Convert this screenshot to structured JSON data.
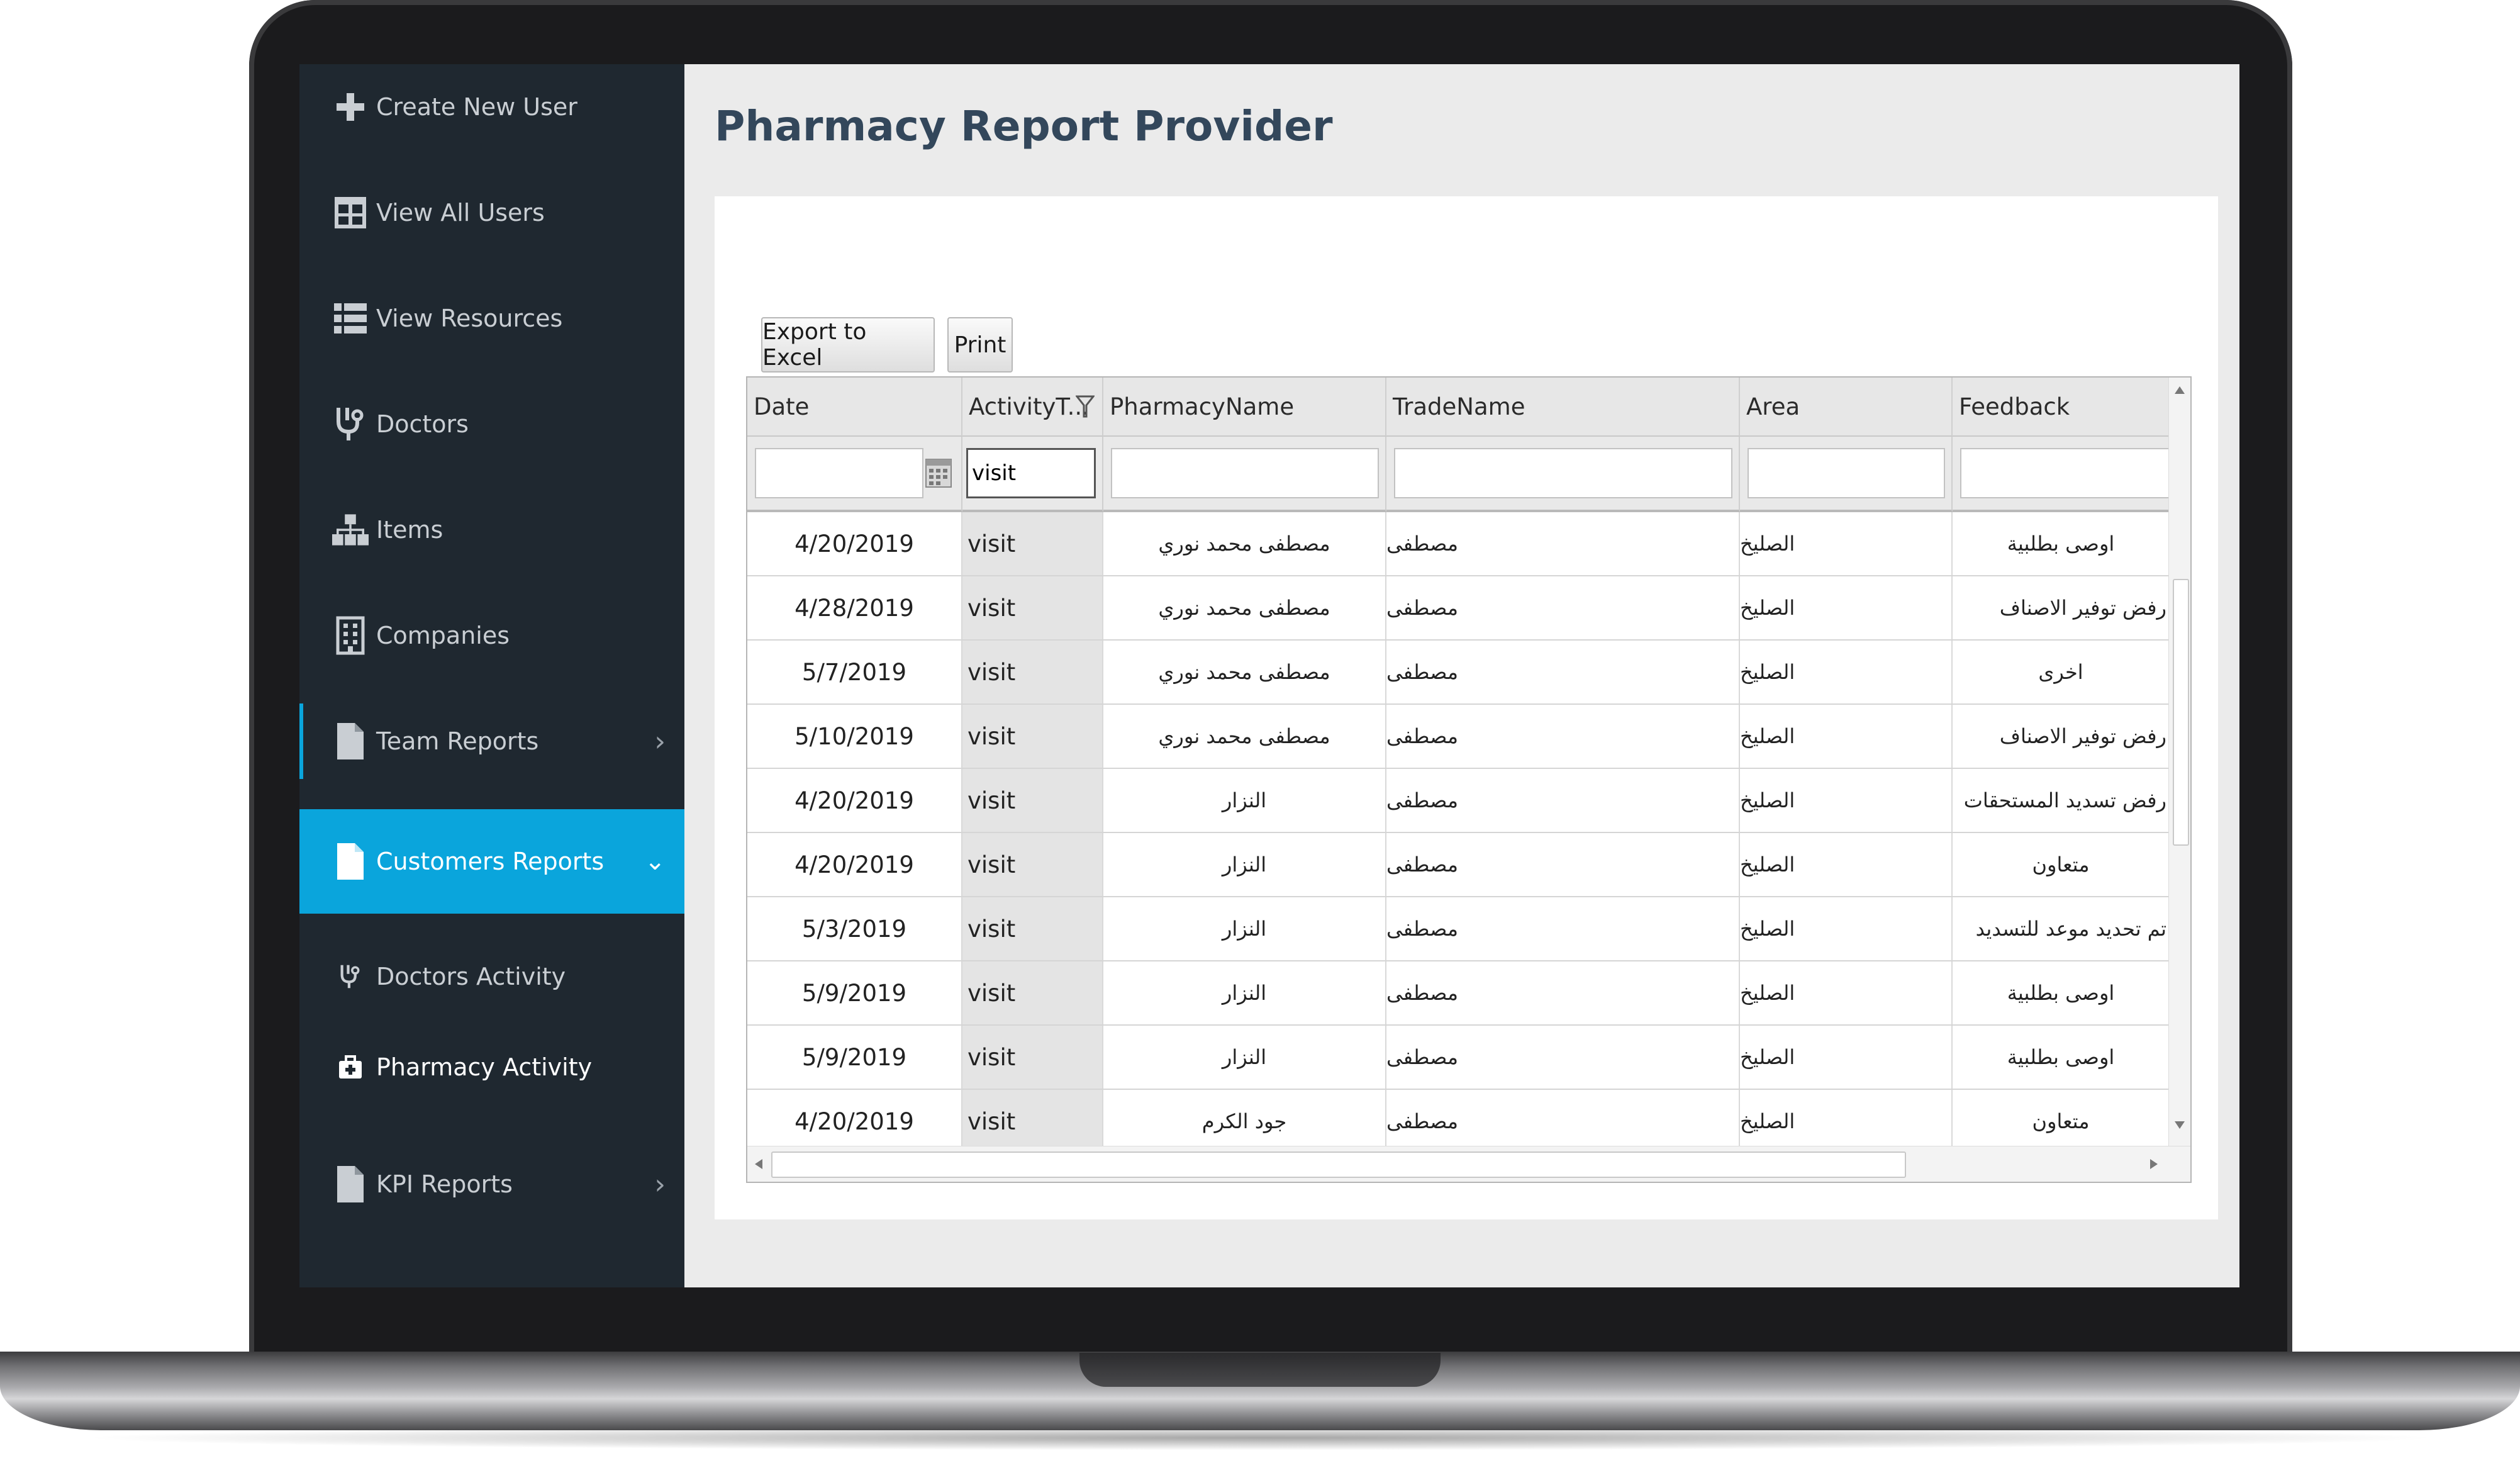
{
  "sidebar": {
    "items": [
      {
        "label": "Create New User",
        "icon": "plus-icon"
      },
      {
        "label": "View All Users",
        "icon": "table-icon"
      },
      {
        "label": "View Resources",
        "icon": "list-icon"
      },
      {
        "label": "Doctors",
        "icon": "stethoscope-icon"
      },
      {
        "label": "Items",
        "icon": "hierarchy-icon"
      },
      {
        "label": "Companies",
        "icon": "building-icon"
      },
      {
        "label": "Team Reports",
        "icon": "document-icon",
        "chevron": "›"
      },
      {
        "label": "Customers Reports",
        "icon": "document-icon",
        "chevron": "⌄"
      },
      {
        "label": "KPI Reports",
        "icon": "document-icon",
        "chevron": "›"
      }
    ],
    "subitems": [
      {
        "label": "Doctors Activity",
        "icon": "stethoscope-icon"
      },
      {
        "label": "Pharmacy Activity",
        "icon": "medical-bag-icon"
      }
    ]
  },
  "page": {
    "title": "Pharmacy Report Provider"
  },
  "toolbar": {
    "export_label": "Export to Excel",
    "print_label": "Print"
  },
  "grid": {
    "columns": [
      "Date",
      "ActivityT...",
      "PharmacyName",
      "TradeName",
      "Area",
      "Feedback"
    ],
    "filters": {
      "date": "",
      "activity": "visit",
      "pharmacy": "",
      "trade": "",
      "area": "",
      "feedback": ""
    },
    "rows": [
      {
        "date": "4/20/2019",
        "activity": "visit",
        "pharmacy": "مصطفى محمد نوري",
        "trade": "مصطفى",
        "area": "الصليخ",
        "feedback": "اوصى بطلبية"
      },
      {
        "date": "4/28/2019",
        "activity": "visit",
        "pharmacy": "مصطفى محمد نوري",
        "trade": "مصطفى",
        "area": "الصليخ",
        "feedback": "رفض توفير الاصناف"
      },
      {
        "date": "5/7/2019",
        "activity": "visit",
        "pharmacy": "مصطفى محمد نوري",
        "trade": "مصطفى",
        "area": "الصليخ",
        "feedback": "اخرى"
      },
      {
        "date": "5/10/2019",
        "activity": "visit",
        "pharmacy": "مصطفى محمد نوري",
        "trade": "مصطفى",
        "area": "الصليخ",
        "feedback": "رفض توفير الاصناف"
      },
      {
        "date": "4/20/2019",
        "activity": "visit",
        "pharmacy": "النزار",
        "trade": "مصطفى",
        "area": "الصليخ",
        "feedback": "رفض تسديد المستحقات"
      },
      {
        "date": "4/20/2019",
        "activity": "visit",
        "pharmacy": "النزار",
        "trade": "مصطفى",
        "area": "الصليخ",
        "feedback": "متعاون"
      },
      {
        "date": "5/3/2019",
        "activity": "visit",
        "pharmacy": "النزار",
        "trade": "مصطفى",
        "area": "الصليخ",
        "feedback": "تم تحديد موعد للتسديد"
      },
      {
        "date": "5/9/2019",
        "activity": "visit",
        "pharmacy": "النزار",
        "trade": "مصطفى",
        "area": "الصليخ",
        "feedback": "اوصى بطلبية"
      },
      {
        "date": "5/9/2019",
        "activity": "visit",
        "pharmacy": "النزار",
        "trade": "مصطفى",
        "area": "الصليخ",
        "feedback": "اوصى بطلبية"
      },
      {
        "date": "4/20/2019",
        "activity": "visit",
        "pharmacy": "جود الكرم",
        "trade": "مصطفى",
        "area": "الصليخ",
        "feedback": "متعاون"
      }
    ]
  },
  "colors": {
    "sidebar_bg": "#1f2830",
    "accent": "#0aa5dc",
    "title": "#33475b"
  }
}
